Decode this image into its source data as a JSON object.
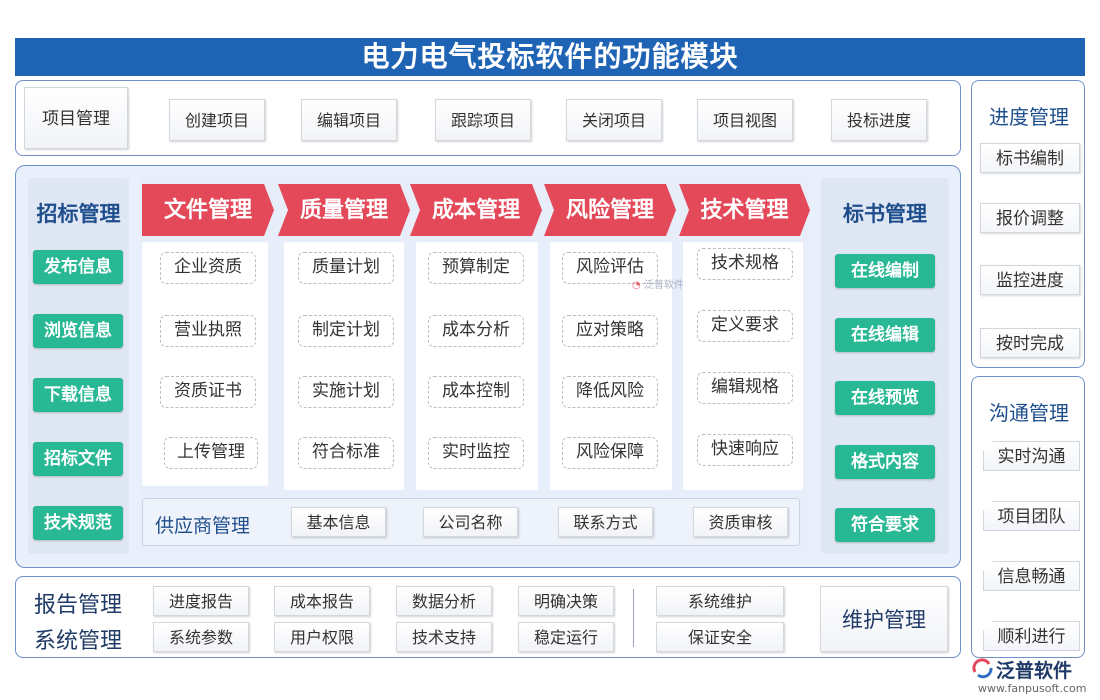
{
  "title": "电力电气投标软件的功能模块",
  "project": {
    "label": "项目管理",
    "items": [
      "创建项目",
      "编辑项目",
      "跟踪项目",
      "关闭项目",
      "项目视图",
      "投标进度"
    ]
  },
  "bidding": {
    "label": "招标管理",
    "items": [
      "发布信息",
      "浏览信息",
      "下载信息",
      "招标文件",
      "技术规范"
    ]
  },
  "modules": [
    {
      "title": "文件管理",
      "items": [
        "企业资质",
        "营业执照",
        "资质证书",
        "上传管理"
      ]
    },
    {
      "title": "质量管理",
      "items": [
        "质量计划",
        "制定计划",
        "实施计划",
        "符合标准"
      ]
    },
    {
      "title": "成本管理",
      "items": [
        "预算制定",
        "成本分析",
        "成本控制",
        "实时监控"
      ]
    },
    {
      "title": "风险管理",
      "items": [
        "风险评估",
        "应对策略",
        "降低风险",
        "风险保障"
      ]
    },
    {
      "title": "技术管理",
      "items": [
        "技术规格",
        "定义要求",
        "编辑规格",
        "快速响应"
      ]
    }
  ],
  "supplier": {
    "label": "供应商管理",
    "items": [
      "基本信息",
      "公司名称",
      "联系方式",
      "资质审核"
    ]
  },
  "tender_doc": {
    "label": "标书管理",
    "items": [
      "在线编制",
      "在线编辑",
      "在线预览",
      "格式内容",
      "符合要求"
    ]
  },
  "report": {
    "label": "报告管理",
    "items": [
      "进度报告",
      "成本报告",
      "数据分析",
      "明确决策"
    ]
  },
  "system": {
    "label": "系统管理",
    "items": [
      "系统参数",
      "用户权限",
      "技术支持",
      "稳定运行"
    ]
  },
  "maintenance": {
    "label": "维护管理",
    "items": [
      "系统维护",
      "保证安全"
    ]
  },
  "progress": {
    "label": "进度管理",
    "items": [
      "标书编制",
      "报价调整",
      "监控进度",
      "按时完成"
    ]
  },
  "communication": {
    "label": "沟通管理",
    "items": [
      "实时沟通",
      "项目团队",
      "信息畅通",
      "顺利进行"
    ]
  },
  "watermark": "泛普软件",
  "logo": {
    "name": "泛普软件",
    "url": "www.fanpusoft.com"
  },
  "colors": {
    "title_bar": "#1f63b5",
    "arrow": "#e4495a",
    "green": "#28b894",
    "border": "#6f8fc9"
  }
}
